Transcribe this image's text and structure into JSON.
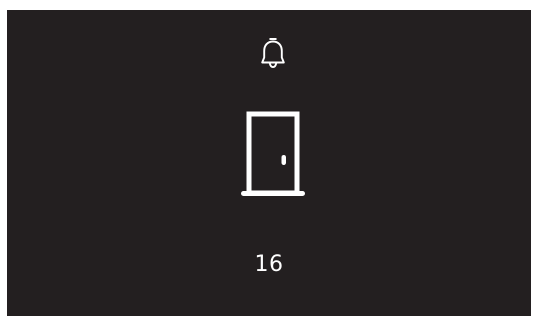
{
  "screen": {
    "background": "#231f20",
    "foreground": "#ffffff"
  },
  "icons": {
    "top": "bell-icon",
    "center": "door-icon"
  },
  "counter": {
    "value": "16"
  }
}
